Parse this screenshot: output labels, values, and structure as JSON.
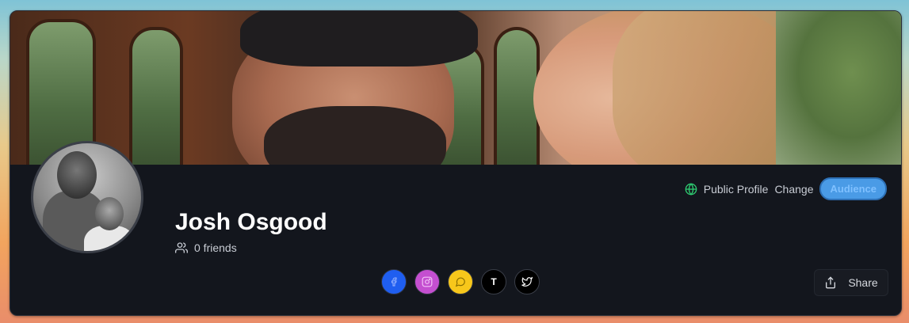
{
  "profile": {
    "name": "Josh Osgood",
    "friends_label": "0 friends"
  },
  "audience": {
    "visibility_label": "Public Profile",
    "change_label": "Change",
    "button_label": "Audience",
    "globe_icon": "globe-icon",
    "accent_color": "#4a9be6",
    "globe_color": "#2ecc71"
  },
  "socials": [
    {
      "name": "facebook",
      "icon": "facebook-icon",
      "color": "#1f5ef0"
    },
    {
      "name": "instagram",
      "icon": "instagram-icon",
      "color": "#c44fd0"
    },
    {
      "name": "snapchat",
      "icon": "snapchat-icon",
      "color": "#f7c71b"
    },
    {
      "name": "tiktok",
      "icon": "tiktok-icon",
      "label": "T",
      "color": "#000000"
    },
    {
      "name": "twitter",
      "icon": "twitter-icon",
      "color": "#000000"
    }
  ],
  "share": {
    "label": "Share",
    "icon": "share-icon"
  },
  "colors": {
    "card_bg": "#13161d",
    "text_primary": "#ffffff",
    "text_secondary": "#c8ccd4"
  }
}
